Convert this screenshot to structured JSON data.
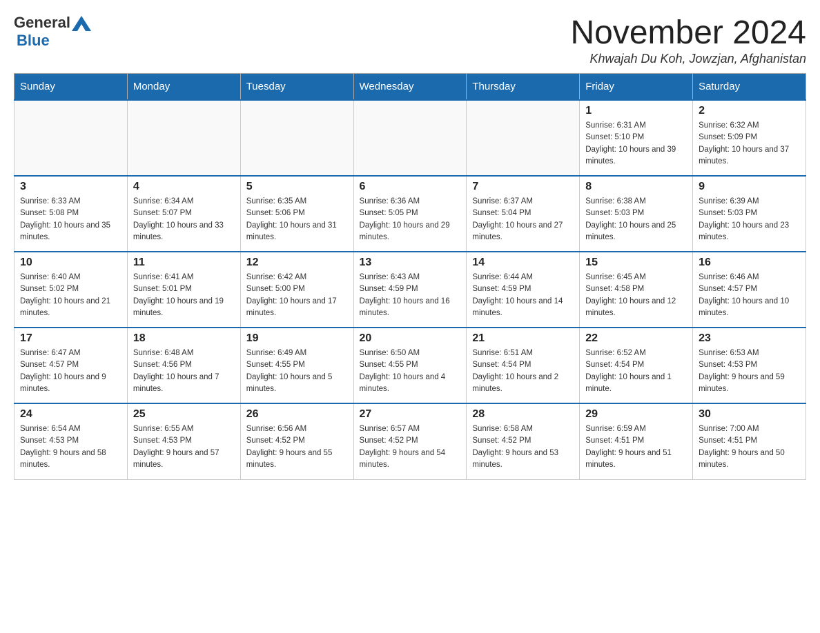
{
  "header": {
    "logo_general": "General",
    "logo_blue": "Blue",
    "title": "November 2024",
    "location": "Khwajah Du Koh, Jowzjan, Afghanistan"
  },
  "days_of_week": [
    "Sunday",
    "Monday",
    "Tuesday",
    "Wednesday",
    "Thursday",
    "Friday",
    "Saturday"
  ],
  "weeks": [
    [
      {
        "day": "",
        "info": ""
      },
      {
        "day": "",
        "info": ""
      },
      {
        "day": "",
        "info": ""
      },
      {
        "day": "",
        "info": ""
      },
      {
        "day": "",
        "info": ""
      },
      {
        "day": "1",
        "info": "Sunrise: 6:31 AM\nSunset: 5:10 PM\nDaylight: 10 hours and 39 minutes."
      },
      {
        "day": "2",
        "info": "Sunrise: 6:32 AM\nSunset: 5:09 PM\nDaylight: 10 hours and 37 minutes."
      }
    ],
    [
      {
        "day": "3",
        "info": "Sunrise: 6:33 AM\nSunset: 5:08 PM\nDaylight: 10 hours and 35 minutes."
      },
      {
        "day": "4",
        "info": "Sunrise: 6:34 AM\nSunset: 5:07 PM\nDaylight: 10 hours and 33 minutes."
      },
      {
        "day": "5",
        "info": "Sunrise: 6:35 AM\nSunset: 5:06 PM\nDaylight: 10 hours and 31 minutes."
      },
      {
        "day": "6",
        "info": "Sunrise: 6:36 AM\nSunset: 5:05 PM\nDaylight: 10 hours and 29 minutes."
      },
      {
        "day": "7",
        "info": "Sunrise: 6:37 AM\nSunset: 5:04 PM\nDaylight: 10 hours and 27 minutes."
      },
      {
        "day": "8",
        "info": "Sunrise: 6:38 AM\nSunset: 5:03 PM\nDaylight: 10 hours and 25 minutes."
      },
      {
        "day": "9",
        "info": "Sunrise: 6:39 AM\nSunset: 5:03 PM\nDaylight: 10 hours and 23 minutes."
      }
    ],
    [
      {
        "day": "10",
        "info": "Sunrise: 6:40 AM\nSunset: 5:02 PM\nDaylight: 10 hours and 21 minutes."
      },
      {
        "day": "11",
        "info": "Sunrise: 6:41 AM\nSunset: 5:01 PM\nDaylight: 10 hours and 19 minutes."
      },
      {
        "day": "12",
        "info": "Sunrise: 6:42 AM\nSunset: 5:00 PM\nDaylight: 10 hours and 17 minutes."
      },
      {
        "day": "13",
        "info": "Sunrise: 6:43 AM\nSunset: 4:59 PM\nDaylight: 10 hours and 16 minutes."
      },
      {
        "day": "14",
        "info": "Sunrise: 6:44 AM\nSunset: 4:59 PM\nDaylight: 10 hours and 14 minutes."
      },
      {
        "day": "15",
        "info": "Sunrise: 6:45 AM\nSunset: 4:58 PM\nDaylight: 10 hours and 12 minutes."
      },
      {
        "day": "16",
        "info": "Sunrise: 6:46 AM\nSunset: 4:57 PM\nDaylight: 10 hours and 10 minutes."
      }
    ],
    [
      {
        "day": "17",
        "info": "Sunrise: 6:47 AM\nSunset: 4:57 PM\nDaylight: 10 hours and 9 minutes."
      },
      {
        "day": "18",
        "info": "Sunrise: 6:48 AM\nSunset: 4:56 PM\nDaylight: 10 hours and 7 minutes."
      },
      {
        "day": "19",
        "info": "Sunrise: 6:49 AM\nSunset: 4:55 PM\nDaylight: 10 hours and 5 minutes."
      },
      {
        "day": "20",
        "info": "Sunrise: 6:50 AM\nSunset: 4:55 PM\nDaylight: 10 hours and 4 minutes."
      },
      {
        "day": "21",
        "info": "Sunrise: 6:51 AM\nSunset: 4:54 PM\nDaylight: 10 hours and 2 minutes."
      },
      {
        "day": "22",
        "info": "Sunrise: 6:52 AM\nSunset: 4:54 PM\nDaylight: 10 hours and 1 minute."
      },
      {
        "day": "23",
        "info": "Sunrise: 6:53 AM\nSunset: 4:53 PM\nDaylight: 9 hours and 59 minutes."
      }
    ],
    [
      {
        "day": "24",
        "info": "Sunrise: 6:54 AM\nSunset: 4:53 PM\nDaylight: 9 hours and 58 minutes."
      },
      {
        "day": "25",
        "info": "Sunrise: 6:55 AM\nSunset: 4:53 PM\nDaylight: 9 hours and 57 minutes."
      },
      {
        "day": "26",
        "info": "Sunrise: 6:56 AM\nSunset: 4:52 PM\nDaylight: 9 hours and 55 minutes."
      },
      {
        "day": "27",
        "info": "Sunrise: 6:57 AM\nSunset: 4:52 PM\nDaylight: 9 hours and 54 minutes."
      },
      {
        "day": "28",
        "info": "Sunrise: 6:58 AM\nSunset: 4:52 PM\nDaylight: 9 hours and 53 minutes."
      },
      {
        "day": "29",
        "info": "Sunrise: 6:59 AM\nSunset: 4:51 PM\nDaylight: 9 hours and 51 minutes."
      },
      {
        "day": "30",
        "info": "Sunrise: 7:00 AM\nSunset: 4:51 PM\nDaylight: 9 hours and 50 minutes."
      }
    ]
  ]
}
